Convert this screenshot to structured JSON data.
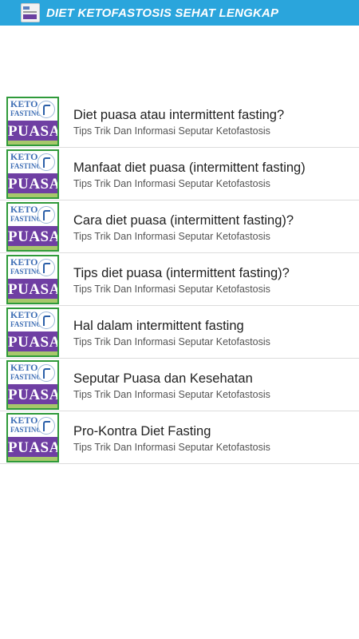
{
  "app_bar": {
    "title": "DIET KETOFASTOSIS SEHAT LENGKAP",
    "icon": "app-icon",
    "color": "#2aa5dc"
  },
  "thumbnail": {
    "keto_text": "KETO",
    "fasting_text": "FASTING",
    "puasa_text": "PUASA",
    "background_color": "#6f3fa3",
    "border_color": "#2f9a3a"
  },
  "items": [
    {
      "title": "Diet puasa atau intermittent fasting?",
      "subtitle": "Tips Trik Dan Informasi Seputar Ketofastosis"
    },
    {
      "title": "Manfaat diet puasa (intermittent fasting)",
      "subtitle": "Tips Trik Dan Informasi Seputar Ketofastosis"
    },
    {
      "title": "Cara diet puasa (intermittent fasting)?",
      "subtitle": "Tips Trik Dan Informasi Seputar Ketofastosis"
    },
    {
      "title": "Tips diet puasa (intermittent fasting)?",
      "subtitle": "Tips Trik Dan Informasi Seputar Ketofastosis"
    },
    {
      "title": "Hal dalam intermittent fasting",
      "subtitle": "Tips Trik Dan Informasi Seputar Ketofastosis"
    },
    {
      "title": "Seputar Puasa dan Kesehatan",
      "subtitle": "Tips Trik Dan Informasi Seputar Ketofastosis"
    },
    {
      "title": "Pro-Kontra Diet Fasting",
      "subtitle": "Tips Trik Dan Informasi Seputar Ketofastosis"
    }
  ]
}
